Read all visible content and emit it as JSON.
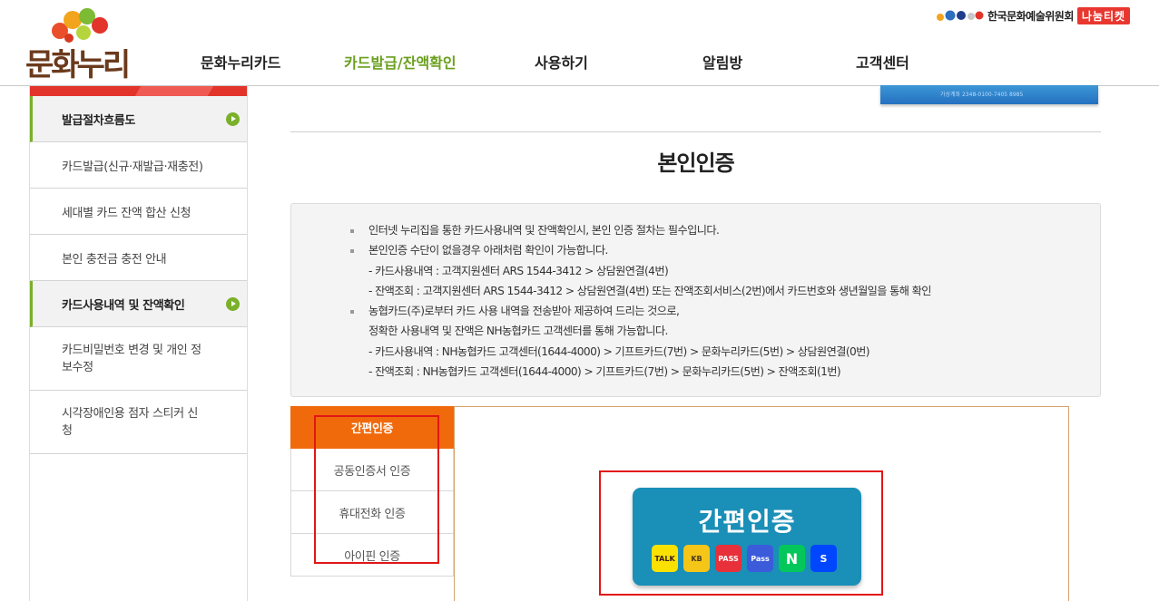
{
  "header": {
    "logo_text": "문화누리",
    "nav": [
      {
        "label": "문화누리카드"
      },
      {
        "label": "카드발급/잔액확인"
      },
      {
        "label": "사용하기"
      },
      {
        "label": "알림방"
      },
      {
        "label": "고객센터"
      }
    ],
    "org_name": "한국문화예술위원회",
    "ticket_label": "나눔티켓"
  },
  "banner": {
    "text": "가상계좌 2348-0100-7405 8985"
  },
  "sidebar": {
    "items": [
      {
        "label": "발급절차흐름도"
      },
      {
        "label": "카드발급(신규·재발급·재충전)"
      },
      {
        "label": "세대별 카드 잔액 합산 신청"
      },
      {
        "label": "본인 충전금 충전 안내"
      },
      {
        "label": "카드사용내역 및 잔액확인"
      },
      {
        "label": "카드비밀번호 변경 및 개인 정보수정"
      },
      {
        "label": "시각장애인용 점자 스티커 신청"
      }
    ]
  },
  "main": {
    "title": "본인인증",
    "notice": [
      "인터넷 누리집을 통한 카드사용내역 및 잔액확인시, 본인 인증 절차는 필수입니다.",
      "본인인증 수단이 없을경우 아래처럼 확인이 가능합니다.",
      "- 카드사용내역 : 고객지원센터 ARS 1544-3412 > 상담원연결(4번)",
      "- 잔액조회 : 고객지원센터 ARS 1544-3412 > 상담원연결(4번) 또는 잔액조회서비스(2번)에서 카드번호와 생년월일을 통해 확인",
      "농협카드(주)로부터 카드 사용 내역을 전송받아 제공하여 드리는 것으로,",
      "정확한 사용내역 및 잔액은 NH농협카드 고객센터를 통해 가능합니다.",
      "- 카드사용내역 : NH농협카드 고객센터(1644-4000) > 기프트카드(7번) > 문화누리카드(5번) > 상담원연결(0번)",
      "- 잔액조회 : NH농협카드 고객센터(1644-4000) > 기프트카드(7번) > 문화누리카드(5번) > 잔액조회(1번)"
    ],
    "tabs": [
      {
        "label": "간편인증"
      },
      {
        "label": "공동인증서 인증"
      },
      {
        "label": "휴대전화 인증"
      },
      {
        "label": "아이핀 인증"
      }
    ],
    "easy_auth": {
      "title": "간편인증",
      "providers": [
        {
          "label": "TALK",
          "icon": "kakao-icon",
          "bg": "#fae100",
          "fg": "#3a1d1d"
        },
        {
          "label": "KB",
          "icon": "kb-icon",
          "bg": "#f5c518",
          "fg": "#4a3a1a"
        },
        {
          "label": "PASS",
          "icon": "pass-red-icon",
          "bg": "#e8303a",
          "fg": "#ffffff"
        },
        {
          "label": "Pass",
          "icon": "pass-blue-icon",
          "bg": "#3b5bdb",
          "fg": "#ffffff"
        },
        {
          "label": "N",
          "icon": "naver-icon",
          "bg": "#03c75a",
          "fg": "#ffffff"
        },
        {
          "label": "S",
          "icon": "shinhan-icon",
          "bg": "#0046ff",
          "fg": "#ffffff"
        }
      ]
    }
  }
}
